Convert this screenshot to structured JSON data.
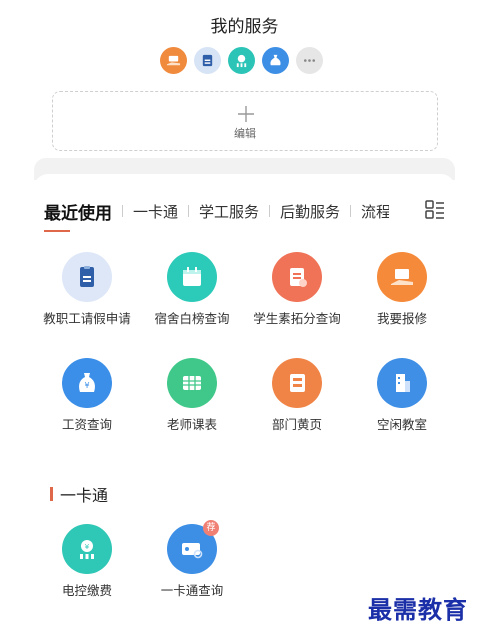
{
  "header": {
    "title": "我的服务"
  },
  "favorites": [
    {
      "icon": "hand-coin-icon",
      "color": "#f08a3c"
    },
    {
      "icon": "id-card-icon",
      "color": "#d7e4f5"
    },
    {
      "icon": "coin-chart-icon",
      "color": "#2cc4b6"
    },
    {
      "icon": "money-bag-icon",
      "color": "#3d8fe6"
    },
    {
      "icon": "more-icon",
      "color": "#e6e6e6"
    }
  ],
  "edit": {
    "label": "编辑"
  },
  "tabs": [
    "最近使用",
    "一卡通",
    "学工服务",
    "后勤服务",
    "流程"
  ],
  "recent": [
    {
      "label": "教职工请假申请",
      "icon": "id-card-icon",
      "color": "#dde7f7"
    },
    {
      "label": "宿舍白榜查询",
      "icon": "calendar-icon",
      "color": "#2ccab8"
    },
    {
      "label": "学生素拓分查询",
      "icon": "notebook-icon",
      "color": "#f07357"
    },
    {
      "label": "我要报修",
      "icon": "hand-laptop-icon",
      "color": "#f58a3a"
    },
    {
      "label": "工资查询",
      "icon": "money-bag-icon",
      "color": "#3b8fe8"
    },
    {
      "label": "老师课表",
      "icon": "table-icon",
      "color": "#3fc889"
    },
    {
      "label": "部门黄页",
      "icon": "book-icon",
      "color": "#f08447"
    },
    {
      "label": "空闲教室",
      "icon": "building-icon",
      "color": "#3f8fe6"
    }
  ],
  "card_section": {
    "title": "一卡通",
    "items": [
      {
        "label": "电控缴费",
        "icon": "coin-chart-icon",
        "color": "#2fc7b5"
      },
      {
        "label": "一卡通查询",
        "icon": "card-search-icon",
        "color": "#3d8fe6",
        "badge": "荐"
      }
    ]
  },
  "watermark": "最需教育"
}
